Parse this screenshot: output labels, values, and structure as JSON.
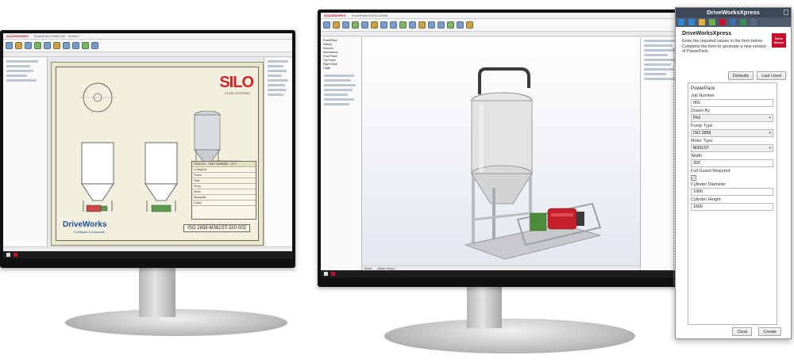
{
  "left_screen": {
    "window_title": "PowerPack-M365-DW - Sheet1 *",
    "app_brand": "SOLIDWORKS",
    "drawing": {
      "company_logo": "SILO",
      "company_sub": "FLUID SYSTEMS",
      "driveworks_logo": "DriveWorks",
      "driveworks_sub": "Configure & Automate",
      "part_number": "ISO 2858-M361ST-320-002",
      "bom_headers": [
        "ITEM NO.",
        "PART NUMBER",
        "QTY."
      ],
      "bom_rows": [
        "ConfigPart",
        "Frame",
        "Tank",
        "Pump",
        "Motor",
        "Baseplate",
        "Guard"
      ]
    }
  },
  "right_screen": {
    "window_title": "PowerPack-DW.SLDASM",
    "app_brand": "SOLIDWORKS",
    "tabs": [
      "Model",
      "Motion Study 1"
    ],
    "tree_items": [
      "PowerPack",
      "History",
      "Sensors",
      "Annotations",
      "Front Plane",
      "Top Plane",
      "Right Plane",
      "Origin"
    ]
  },
  "dwx": {
    "window_title": "DriveWorksXpress",
    "heading": "DriveWorksXpress",
    "instructions": "Enter the required values in the form below. Complete the form to generate a new version of PowerPack.",
    "logo_text": "Drive Works",
    "defaults_label": "Defaults",
    "last_used_label": "Last Used",
    "form_title": "PowerPack",
    "fields": {
      "job_number": {
        "label": "Job Number",
        "value": "001"
      },
      "drawn_by": {
        "label": "Drawn By",
        "value": "Phil"
      },
      "pump_type": {
        "label": "Pump Type",
        "value": "ISO 2858"
      },
      "motor_type": {
        "label": "Motor Type",
        "value": "M361ST"
      },
      "width": {
        "label": "Width",
        "value": "320"
      },
      "full_guard": {
        "label": "Full Guard Required",
        "value": "checked"
      },
      "cylinder_diameter": {
        "label": "Cylinder Diameter",
        "value": "1000"
      },
      "cylinder_height": {
        "label": "Cylinder Height",
        "value": "1500"
      }
    },
    "clear_label": "Clear",
    "create_label": "Create"
  }
}
